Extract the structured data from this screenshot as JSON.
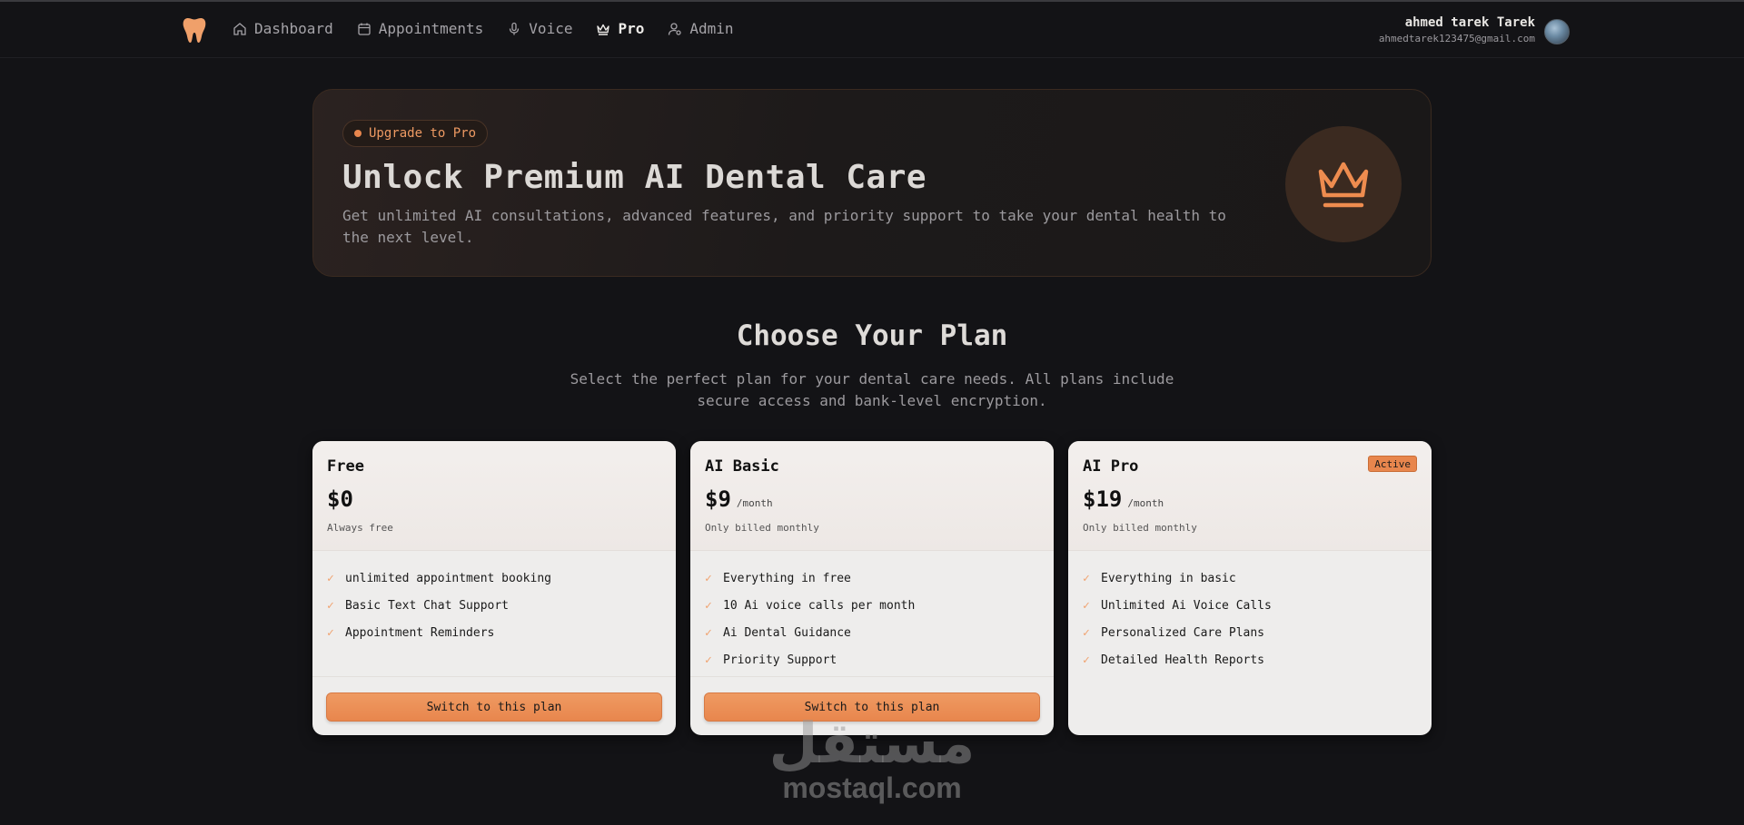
{
  "nav": {
    "links": [
      {
        "label": "Dashboard",
        "icon": "home-icon"
      },
      {
        "label": "Appointments",
        "icon": "calendar-icon"
      },
      {
        "label": "Voice",
        "icon": "microphone-icon"
      },
      {
        "label": "Pro",
        "icon": "crown-icon",
        "active": true
      },
      {
        "label": "Admin",
        "icon": "user-cog-icon"
      }
    ],
    "user": {
      "name": "ahmed tarek Tarek",
      "email": "ahmedtarek123475@gmail.com"
    }
  },
  "hero": {
    "badge": "Upgrade to Pro",
    "title": "Unlock Premium AI Dental Care",
    "description": "Get unlimited AI consultations, advanced features, and priority support to take your dental health to the next level."
  },
  "section": {
    "title": "Choose Your Plan",
    "description": "Select the perfect plan for your dental care needs. All plans include secure access and bank-level encryption."
  },
  "plans": [
    {
      "name": "Free",
      "price": "$0",
      "period": "",
      "note": "Always free",
      "features": [
        "unlimited appointment booking",
        "Basic Text Chat Support",
        "Appointment Reminders"
      ],
      "button": "Switch to this plan"
    },
    {
      "name": "AI Basic",
      "price": "$9",
      "period": "/month",
      "note": "Only billed monthly",
      "features": [
        "Everything in free",
        "10 Ai voice calls per month",
        "Ai Dental Guidance",
        "Priority Support"
      ],
      "button": "Switch to this plan"
    },
    {
      "name": "AI Pro",
      "price": "$19",
      "period": "/month",
      "note": "Only billed monthly",
      "badge": "Active",
      "features": [
        "Everything in basic",
        "Unlimited Ai Voice Calls",
        "Personalized Care Plans",
        "Detailed Health Reports"
      ]
    }
  ],
  "watermark": {
    "arabic": "مستقل",
    "latin": "mostaql.com"
  },
  "colors": {
    "accent": "#e8864d",
    "background": "#131316",
    "card": "#eeedec"
  }
}
